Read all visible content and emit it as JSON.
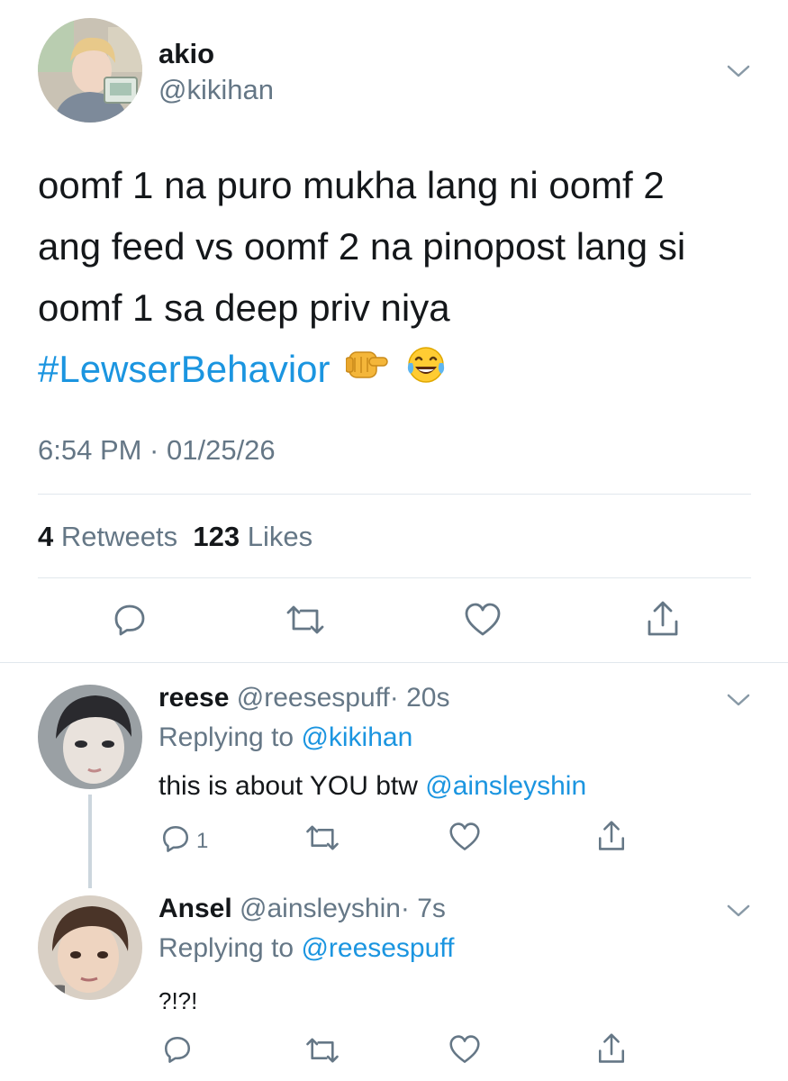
{
  "tweet": {
    "display_name": "akio",
    "handle": "@kikihan",
    "text_lines": [
      "oomf 1 na puro mukha lang ni oomf 2",
      "ang feed vs oomf 2 na pinopost lang si",
      "oomf 1 sa deep priv niya"
    ],
    "hashtag": "#LewserBehavior",
    "emojis": [
      "pointing-fist-emoji",
      "tears-of-joy-emoji"
    ],
    "timestamp": "6:54 PM · 01/25/26",
    "retweets_count": "4",
    "retweets_label": "Retweets",
    "likes_count": "123",
    "likes_label": "Likes",
    "actions": [
      "reply-icon",
      "retweet-icon",
      "like-icon",
      "share-icon"
    ]
  },
  "replies": [
    {
      "display_name": "reese",
      "handle": "@reesespuff",
      "time": "· 20s",
      "replying_prefix": "Replying to",
      "replying_to": "@kikihan",
      "text": "this is about YOU btw",
      "mention": "@ainsleyshin",
      "reply_count": "1"
    },
    {
      "display_name": "Ansel",
      "handle": "@ainsleyshin",
      "time": "· 7s",
      "replying_prefix": "Replying to",
      "replying_to": "@reesespuff",
      "text": "?!?!"
    }
  ],
  "colors": {
    "text": "#14171a",
    "secondary": "#657786",
    "link": "#1b95e0",
    "divider": "#e1e8ed"
  }
}
